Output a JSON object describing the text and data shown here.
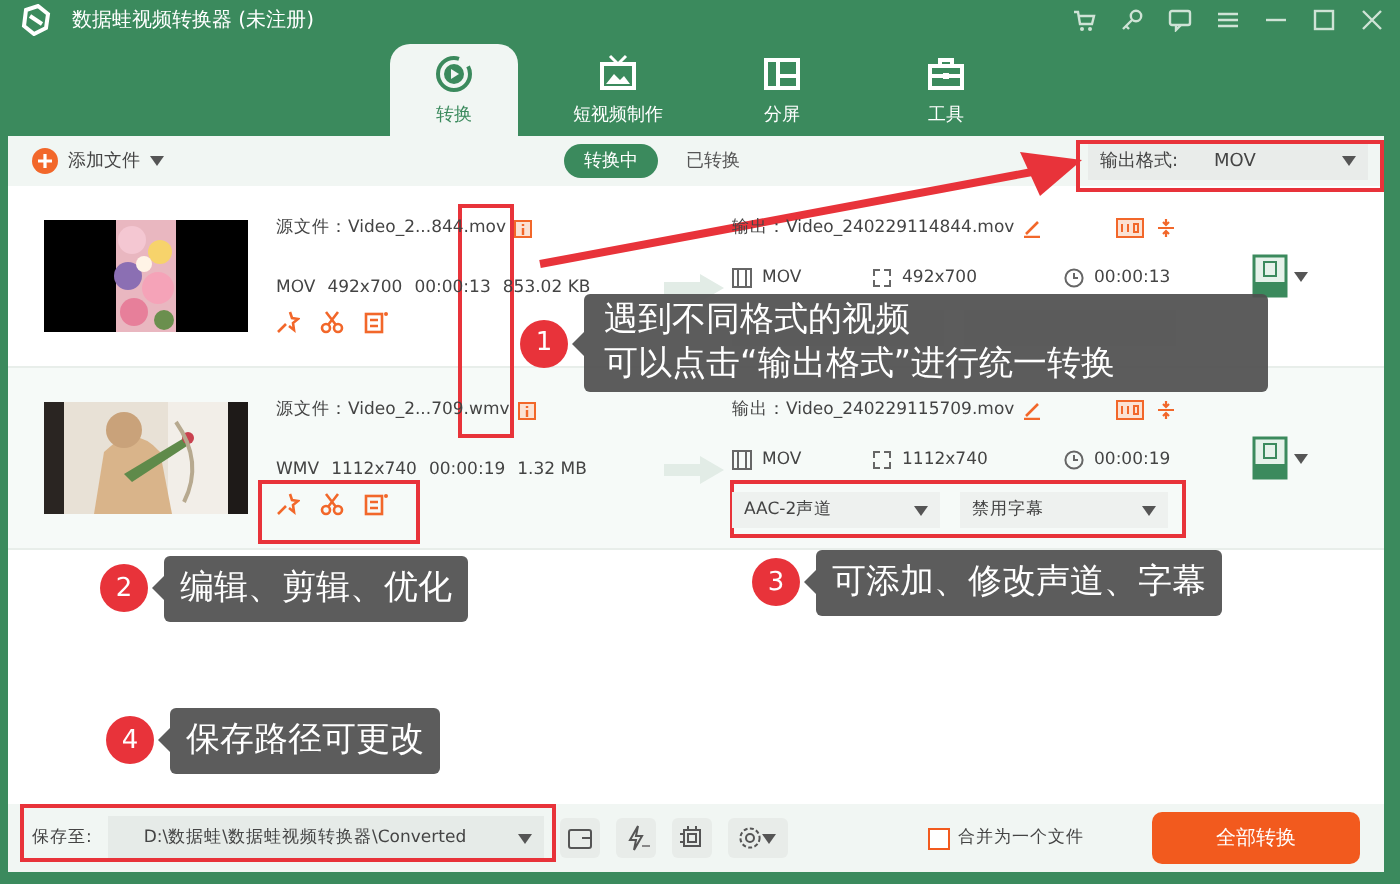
{
  "window": {
    "title": "数据蛙视频转换器 (未注册)"
  },
  "tabs": [
    {
      "label": "转换",
      "selected": true,
      "kind": "convert"
    },
    {
      "label": "短视频制作",
      "selected": false,
      "kind": "tv"
    },
    {
      "label": "分屏",
      "selected": false,
      "kind": "split"
    },
    {
      "label": "工具",
      "selected": false,
      "kind": "toolbox"
    }
  ],
  "toolbar": {
    "add_file": "添加文件",
    "filters": [
      {
        "label": "转换中",
        "selected": true
      },
      {
        "label": "已转换",
        "selected": false
      }
    ],
    "output_format": {
      "label": "输出格式:",
      "value": "MOV"
    }
  },
  "files": [
    {
      "source": "源文件：Video_2...844.mov",
      "format": "MOV",
      "resolution": "492x700",
      "duration": "00:00:13",
      "size": "853.02 KB",
      "output": "输出：Video_240229114844.mov",
      "out_format": "MOV",
      "out_resolution": "492x700",
      "out_duration": "00:00:13"
    },
    {
      "source": "源文件：Video_2...709.wmv",
      "format": "WMV",
      "resolution": "1112x740",
      "duration": "00:00:19",
      "size": "1.32 MB",
      "output": "输出：Video_240229115709.mov",
      "out_format": "MOV",
      "out_resolution": "1112x740",
      "out_duration": "00:00:19",
      "audio": "AAC-2声道",
      "subtitle": "禁用字幕"
    }
  ],
  "footer": {
    "save_label": "保存至:",
    "path": "D:\\数据蛙\\数据蛙视频转换器\\Converted",
    "merge": {
      "label": "合并为一个文件",
      "checked": false
    },
    "convert_all": "全部转换"
  },
  "callouts": [
    {
      "number": "1",
      "lines": [
        "遇到不同格式的视频",
        "可以点击“输出格式”进行统一转换"
      ]
    },
    {
      "number": "2",
      "lines": [
        "编辑、剪辑、优化"
      ]
    },
    {
      "number": "3",
      "lines": [
        "可添加、修改声道、字幕"
      ]
    },
    {
      "number": "4",
      "lines": [
        "保存路径可更改"
      ]
    }
  ]
}
